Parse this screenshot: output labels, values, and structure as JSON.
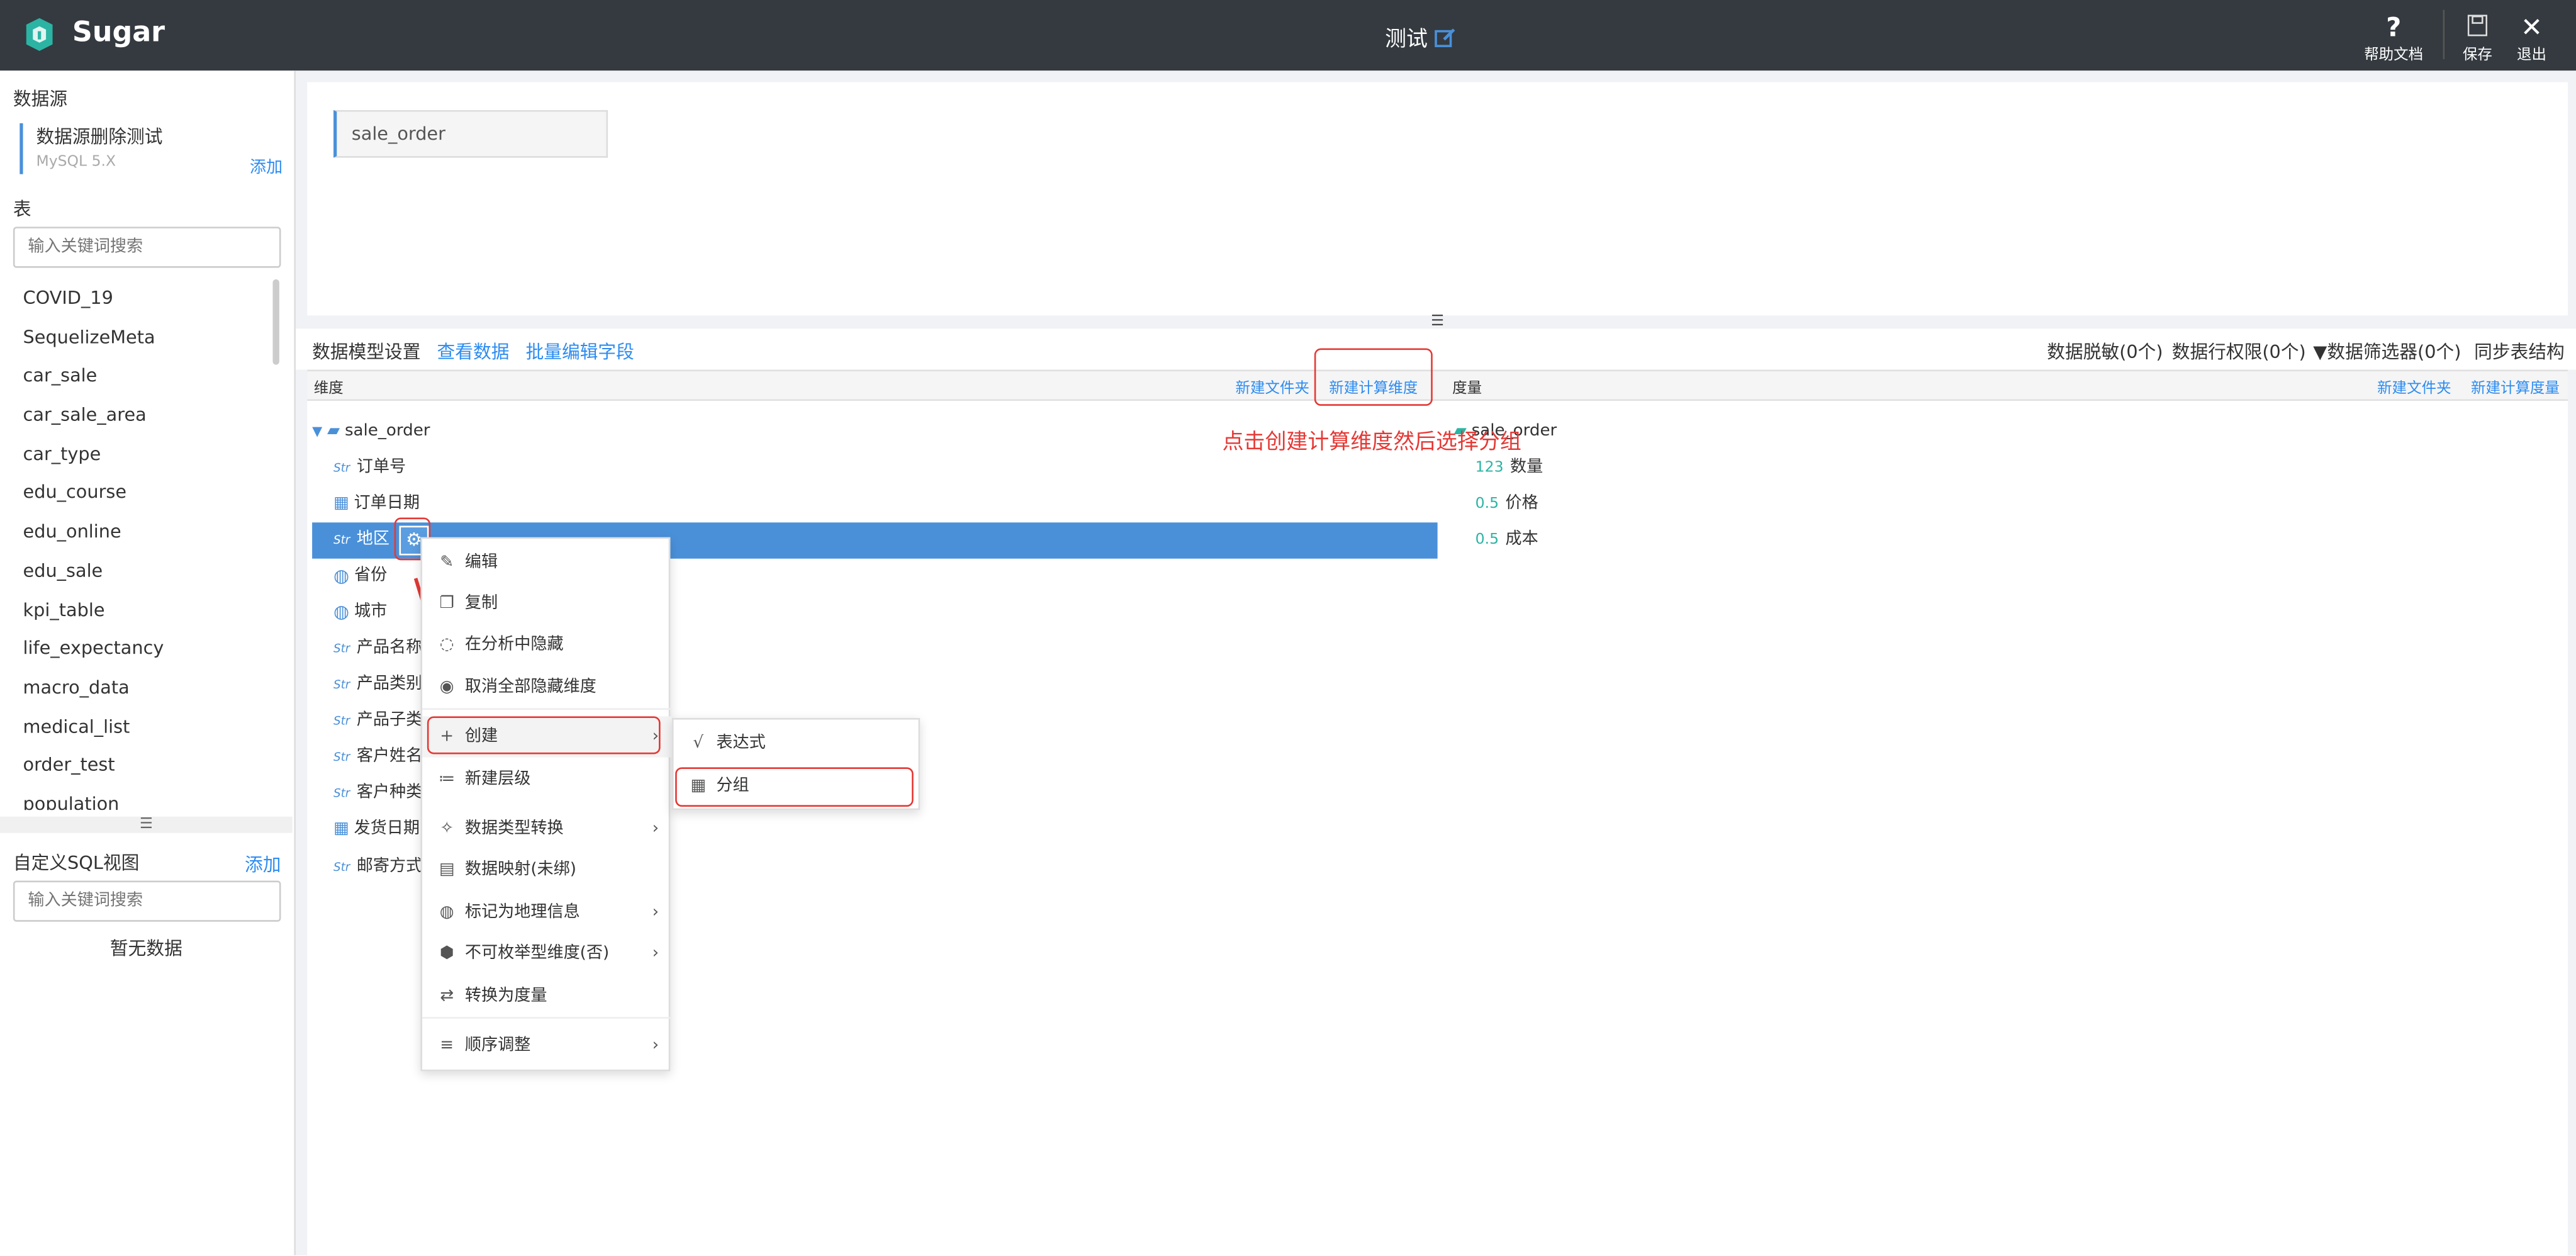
{
  "app": {
    "name": "Sugar"
  },
  "header": {
    "title": "测试",
    "help_label": "帮助文档",
    "save_label": "保存",
    "exit_label": "退出"
  },
  "sidebar": {
    "datasource_title": "数据源",
    "datasource_name": "数据源删除测试",
    "datasource_type": "MySQL 5.X",
    "add_label": "添加",
    "table_title": "表",
    "search_placeholder": "输入关键词搜索",
    "tables": [
      "COVID_19",
      "SequelizeMeta",
      "car_sale",
      "car_sale_area",
      "car_type",
      "edu_course",
      "edu_online",
      "edu_sale",
      "kpi_table",
      "life_expectancy",
      "macro_data",
      "medical_list",
      "order_test",
      "population"
    ],
    "sql_title": "自定义SQL视图",
    "sql_add_label": "添加",
    "sql_search_placeholder": "输入关键词搜索",
    "sql_empty": "暂无数据"
  },
  "canvas": {
    "table_chip": "sale_order"
  },
  "toolbar": {
    "model_settings": "数据模型设置",
    "view_data": "查看数据",
    "batch_edit": "批量编辑字段",
    "masking": "数据脱敏(0个)",
    "row_perm": "数据行权限(0个)",
    "filter": "数据筛选器(0个)",
    "sync": "同步表结构"
  },
  "dims": {
    "header": "维度",
    "new_folder": "新建文件夹",
    "new_calc": "新建计算维度",
    "folder": "sale_order",
    "fields": [
      {
        "type": "str",
        "name": "订单号"
      },
      {
        "type": "date",
        "name": "订单日期"
      },
      {
        "type": "str",
        "name": "地区"
      },
      {
        "type": "geo",
        "name": "省份"
      },
      {
        "type": "geo",
        "name": "城市"
      },
      {
        "type": "str",
        "name": "产品名称"
      },
      {
        "type": "str",
        "name": "产品类别"
      },
      {
        "type": "str",
        "name": "产品子类"
      },
      {
        "type": "str",
        "name": "客户姓名"
      },
      {
        "type": "str",
        "name": "客户种类"
      },
      {
        "type": "date",
        "name": "发货日期"
      },
      {
        "type": "str",
        "name": "邮寄方式"
      }
    ]
  },
  "measures": {
    "header": "度量",
    "new_folder": "新建文件夹",
    "new_calc": "新建计算度量",
    "folder": "sale_order",
    "fields": [
      {
        "badge": "123",
        "name": "数量"
      },
      {
        "badge": "0.5",
        "name": "价格"
      },
      {
        "badge": "0.5",
        "name": "成本"
      }
    ]
  },
  "annotation": "点击创建计算维度然后选择分组",
  "context_menu": [
    "编辑",
    "复制",
    "在分析中隐藏",
    "取消全部隐藏维度",
    "创建",
    "新建层级",
    "数据类型转换",
    "数据映射(未绑)",
    "标记为地理信息",
    "不可枚举型维度(否)",
    "转换为度量",
    "顺序调整"
  ],
  "submenu": [
    "表达式",
    "分组"
  ],
  "colors": {
    "accent": "#4a90d9",
    "topbar": "#343a40",
    "highlight": "#e53935",
    "link": "#2d8cf0"
  }
}
